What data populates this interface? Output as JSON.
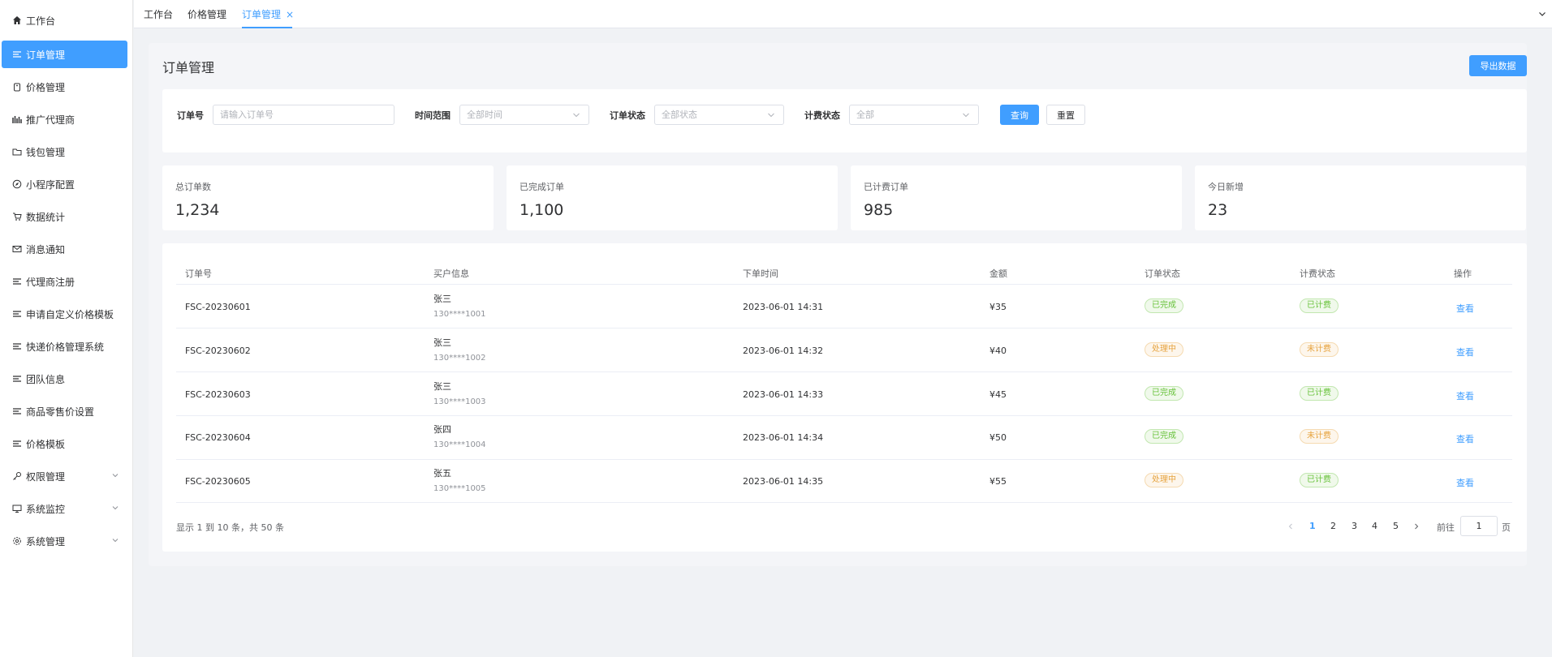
{
  "sidebar": {
    "items": [
      {
        "label": "工作台",
        "icon": "home-icon"
      },
      {
        "label": "订单管理",
        "icon": "list-icon",
        "active": true
      },
      {
        "label": "价格管理",
        "icon": "tag-icon"
      },
      {
        "label": "推广代理商",
        "icon": "chart-icon"
      },
      {
        "label": "钱包管理",
        "icon": "folder-icon"
      },
      {
        "label": "小程序配置",
        "icon": "compass-icon"
      },
      {
        "label": "数据统计",
        "icon": "cart-icon"
      },
      {
        "label": "消息通知",
        "icon": "mail-icon"
      },
      {
        "label": "代理商注册",
        "icon": "list-icon"
      },
      {
        "label": "申请自定义价格模板",
        "icon": "list-icon"
      },
      {
        "label": "快递价格管理系统",
        "icon": "list-icon"
      },
      {
        "label": "团队信息",
        "icon": "list-icon"
      },
      {
        "label": "商品零售价设置",
        "icon": "list-icon"
      },
      {
        "label": "价格模板",
        "icon": "list-icon"
      },
      {
        "label": "权限管理",
        "icon": "key-icon",
        "expandable": true
      },
      {
        "label": "系统监控",
        "icon": "monitor-icon",
        "expandable": true
      },
      {
        "label": "系统管理",
        "icon": "gear-icon",
        "expandable": true
      }
    ]
  },
  "tabs": [
    {
      "label": "工作台"
    },
    {
      "label": "价格管理"
    },
    {
      "label": "订单管理",
      "active": true,
      "close": "×"
    }
  ],
  "page": {
    "title": "订单管理",
    "export_label": "导出数据"
  },
  "filters": {
    "order_no_label": "订单号",
    "order_no_placeholder": "请输入订单号",
    "time_label": "时间范围",
    "time_value": "全部时间",
    "status_label": "订单状态",
    "status_value": "全部状态",
    "billing_label": "计费状态",
    "billing_value": "全部",
    "search_label": "查询",
    "reset_label": "重置"
  },
  "stats": [
    {
      "label": "总订单数",
      "value": "1,234"
    },
    {
      "label": "已完成订单",
      "value": "1,100"
    },
    {
      "label": "已计费订单",
      "value": "985"
    },
    {
      "label": "今日新增",
      "value": "23"
    }
  ],
  "table": {
    "columns": [
      "订单号",
      "买户信息",
      "下单时间",
      "金额",
      "订单状态",
      "计费状态",
      "操作"
    ],
    "rows": [
      {
        "order_no": "FSC-20230601",
        "buyer": "张三",
        "phone": "130****1001",
        "time": "2023-06-01 14:31",
        "amount": "¥35",
        "status": "已完成",
        "billing": "已计费",
        "action": "查看"
      },
      {
        "order_no": "FSC-20230602",
        "buyer": "张三",
        "phone": "130****1002",
        "time": "2023-06-01 14:32",
        "amount": "¥40",
        "status": "处理中",
        "billing": "未计费",
        "action": "查看"
      },
      {
        "order_no": "FSC-20230603",
        "buyer": "张三",
        "phone": "130****1003",
        "time": "2023-06-01 14:33",
        "amount": "¥45",
        "status": "已完成",
        "billing": "已计费",
        "action": "查看"
      },
      {
        "order_no": "FSC-20230604",
        "buyer": "张四",
        "phone": "130****1004",
        "time": "2023-06-01 14:34",
        "amount": "¥50",
        "status": "已完成",
        "billing": "未计费",
        "action": "查看"
      },
      {
        "order_no": "FSC-20230605",
        "buyer": "张五",
        "phone": "130****1005",
        "time": "2023-06-01 14:35",
        "amount": "¥55",
        "status": "处理中",
        "billing": "已计费",
        "action": "查看"
      }
    ]
  },
  "pagination": {
    "summary": "显示 1 到 10 条，共 50 条",
    "pages": [
      "1",
      "2",
      "3",
      "4",
      "5"
    ],
    "current": "1",
    "goto_label": "前往",
    "goto_value": "1",
    "goto_suffix": "页"
  },
  "colors": {
    "primary": "#409eff",
    "success": "#67c23a",
    "warning": "#e6a23c"
  }
}
